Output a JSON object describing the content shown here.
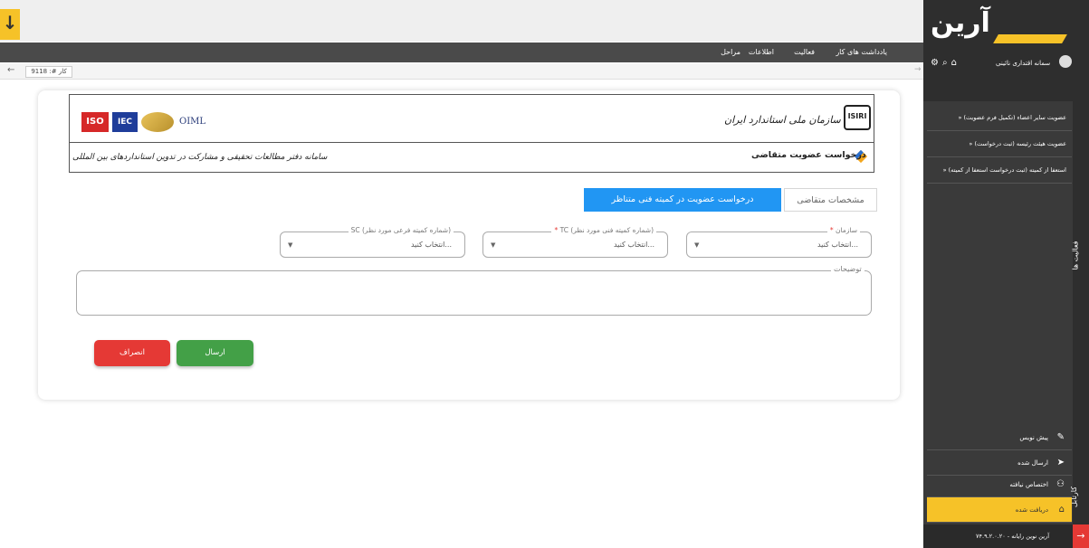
{
  "topbar": {
    "nav": [
      "مراحل",
      "اطلاعات",
      "فعالیت",
      "یادداشت های کار"
    ],
    "job_label": "کار #: 9118"
  },
  "header": {
    "org_name": "سازمان ملی استاندارد ایران",
    "request_title": "درخواست عضویت متقاضی",
    "system_name": "سامانه دفتر مطالعات تحقیقی و مشارکت در تدوین استانداردهای بین المللی",
    "logos": [
      "ISO",
      "IEC",
      "OIML"
    ]
  },
  "tabs": {
    "active": "درخواست عضویت در کمیته فنی متناظر",
    "inactive": "مشخصات متقاضی"
  },
  "form": {
    "org": {
      "label": "سازمان",
      "placeholder": "انتخاب کنید..."
    },
    "tc": {
      "label": "TC (شماره کمیته فنی مورد نظر)",
      "placeholder": "انتخاب کنید..."
    },
    "sc": {
      "label": "SC (شماره کمیته فرعی مورد نظر)",
      "placeholder": "انتخاب کنید..."
    },
    "description_label": "توضیحات",
    "submit": "ارسال",
    "cancel": "انصراف"
  },
  "sidebar": {
    "brand": "آرین",
    "user_name": "سمانه اقتداری نائینی",
    "menu": [
      "عضویت سایر اعضاء (تکمیل فرم عضویت)",
      "عضویت هیئت رئیسه (ثبت درخواست)",
      "استعفا از کمیته (ثبت درخواست استعفا از کمیته)"
    ],
    "side_tab_top": "فعالیت ها",
    "side_tab_bottom": "کارتابل",
    "inbox": [
      {
        "label": "دریافت شده",
        "icon": "inbox-icon"
      },
      {
        "label": "ارسال شده",
        "icon": "send-icon"
      },
      {
        "label": "اختصاص نیافته",
        "icon": "users-icon"
      },
      {
        "label": "پیش نویس",
        "icon": "pencil-icon"
      }
    ],
    "footer": "آرین نوین رایانه - ۷۴.۹.۲.۰.۲۰"
  },
  "colors": {
    "accent": "#2196f3",
    "brand": "#f6c228",
    "submit": "#43a047",
    "cancel": "#e53935"
  }
}
